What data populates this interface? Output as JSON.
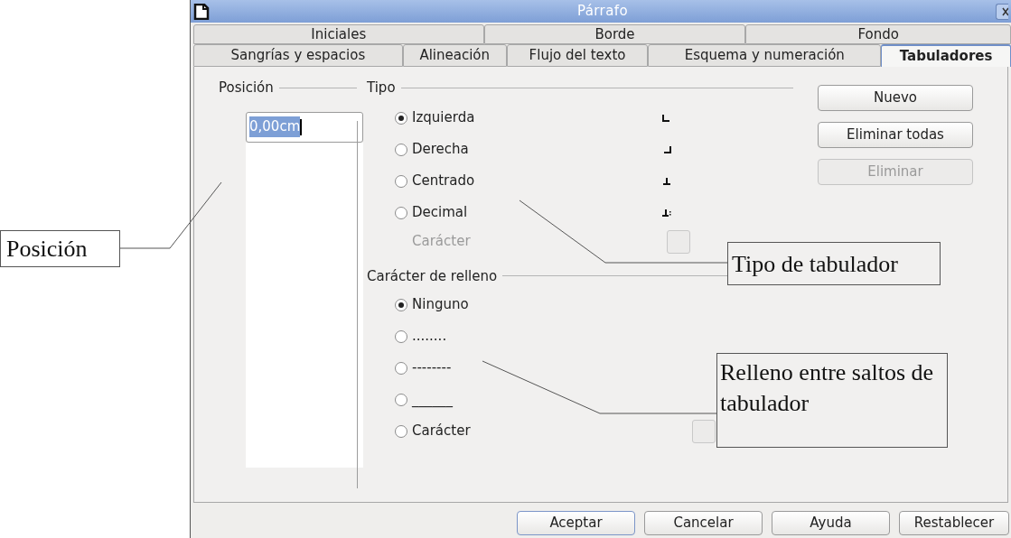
{
  "window": {
    "title": "Párrafo"
  },
  "tabs_row_1": [
    {
      "label": "Iniciales",
      "selected": false
    },
    {
      "label": "Borde",
      "selected": false
    },
    {
      "label": "Fondo",
      "selected": false
    }
  ],
  "tabs_row_2": [
    {
      "label": "Sangrías y espacios",
      "selected": false
    },
    {
      "label": "Alineación",
      "selected": false
    },
    {
      "label": "Flujo del texto",
      "selected": false
    },
    {
      "label": "Esquema y numeración",
      "selected": false
    },
    {
      "label": "Tabuladores",
      "selected": true
    }
  ],
  "position": {
    "label": "Posición",
    "value": "0,00cm",
    "text_selected": true
  },
  "type": {
    "label": "Tipo",
    "options": [
      {
        "label": "Izquierda",
        "selected": true,
        "kind": "left"
      },
      {
        "label": "Derecha",
        "selected": false,
        "kind": "right"
      },
      {
        "label": "Centrado",
        "selected": false,
        "kind": "center"
      },
      {
        "label": "Decimal",
        "selected": false,
        "kind": "decimal"
      }
    ],
    "character": {
      "label": "Carácter",
      "disabled": true
    }
  },
  "fill": {
    "label": "Carácter de relleno",
    "options": [
      {
        "label": "Ninguno",
        "selected": true
      },
      {
        "label": "........",
        "selected": false
      },
      {
        "label": "--------",
        "selected": false
      },
      {
        "label": "______",
        "selected": false
      },
      {
        "label": "Carácter",
        "selected": false
      }
    ]
  },
  "side_buttons": [
    {
      "label": "Nuevo",
      "disabled": false
    },
    {
      "label": "Eliminar todas",
      "disabled": false
    },
    {
      "label": "Eliminar",
      "disabled": true
    }
  ],
  "bottom_buttons": [
    {
      "label": "Aceptar",
      "default": true
    },
    {
      "label": "Cancelar",
      "default": false
    },
    {
      "label": "Ayuda",
      "default": false
    },
    {
      "label": "Restablecer",
      "default": false
    }
  ],
  "annotations": [
    {
      "text": "Posición"
    },
    {
      "text": "Tipo de tabulador"
    },
    {
      "text": "Relleno entre saltos de tabulador"
    }
  ]
}
